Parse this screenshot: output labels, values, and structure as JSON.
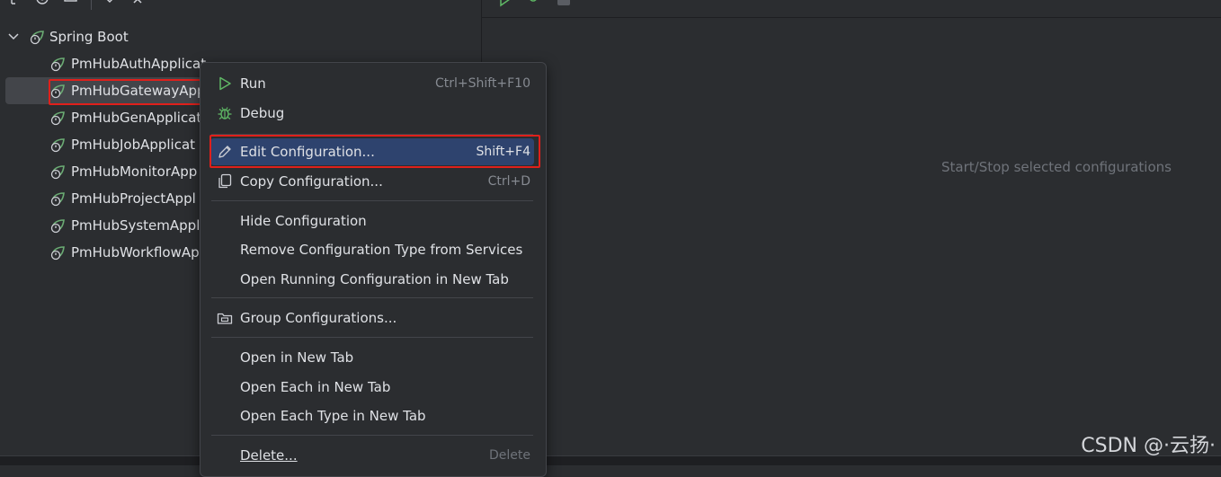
{
  "tree": {
    "group_label": "Spring Boot",
    "items": [
      {
        "label": "PmHubAuthApplicat"
      },
      {
        "label": "PmHubGatewayApp"
      },
      {
        "label": "PmHubGenApplicat"
      },
      {
        "label": "PmHubJobApplicat"
      },
      {
        "label": "PmHubMonitorApp"
      },
      {
        "label": "PmHubProjectAppl"
      },
      {
        "label": "PmHubSystemAppl"
      },
      {
        "label": "PmHubWorkflowAp"
      }
    ]
  },
  "right_panel": {
    "hint": "Start/Stop selected configurations"
  },
  "context_menu": {
    "run": {
      "label": "Run",
      "shortcut": "Ctrl+Shift+F10"
    },
    "debug": {
      "label": "Debug"
    },
    "edit": {
      "label": "Edit Configuration...",
      "shortcut": "Shift+F4"
    },
    "copy": {
      "label": "Copy Configuration...",
      "shortcut": "Ctrl+D"
    },
    "hide": {
      "label": "Hide Configuration"
    },
    "remove_type": {
      "label": "Remove Configuration Type from Services"
    },
    "open_running": {
      "label": "Open Running Configuration in New Tab"
    },
    "group": {
      "label": "Group Configurations..."
    },
    "open_new_tab": {
      "label": "Open in New Tab"
    },
    "open_each": {
      "label": "Open Each in New Tab"
    },
    "open_each_type": {
      "label": "Open Each Type in New Tab"
    },
    "delete": {
      "label": "Delete...",
      "shortcut": "Delete"
    }
  },
  "watermark": "CSDN @·云扬·",
  "colors": {
    "background": "#2b2d30",
    "menu_highlight": "#2e436e",
    "annotation_red": "#e0201b",
    "run_green": "#5fb865",
    "spring_green": "#6aab73"
  }
}
